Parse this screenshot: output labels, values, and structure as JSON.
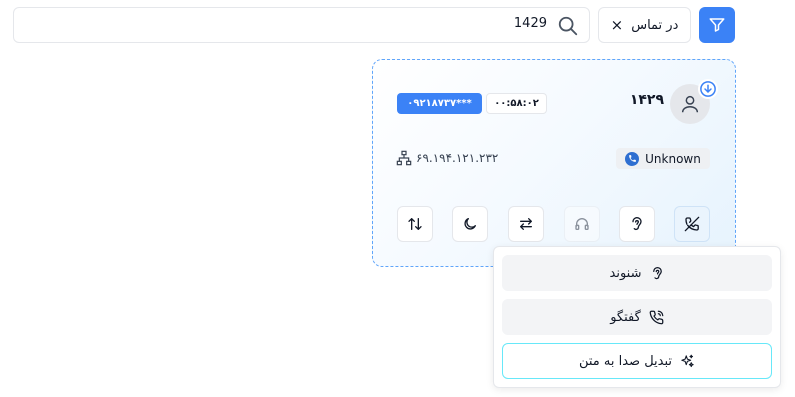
{
  "filter": {
    "icon": "funnel-icon",
    "accent": "#3b82f6"
  },
  "status_filter": {
    "label": "در تماس",
    "clear": "×"
  },
  "search": {
    "value": "1429",
    "icon": "search-icon"
  },
  "call_card": {
    "extension": "۱۴۲۹",
    "duration": "۰۰:۵۸:۰۲",
    "phone": "۰۹۲۱۸۷۳۷***",
    "caller_name": "Unknown",
    "ip_address": "۶۹.۱۹۴.۱۲۱.۲۳۲",
    "actions": [
      {
        "name": "swap-vertical-icon",
        "enabled": true
      },
      {
        "name": "moon-icon",
        "enabled": true
      },
      {
        "name": "transfer-icon",
        "enabled": true
      },
      {
        "name": "headset-icon",
        "enabled": false
      },
      {
        "name": "ear-icon",
        "enabled": true
      },
      {
        "name": "phone-off-icon",
        "enabled": true
      }
    ]
  },
  "menu": {
    "items": [
      {
        "label": "شنوند",
        "icon": "ear-icon"
      },
      {
        "label": "گفتگو",
        "icon": "phone-call-icon"
      },
      {
        "label": "تبدیل صدا به متن",
        "icon": "sparkles-icon",
        "selected": true
      }
    ]
  }
}
